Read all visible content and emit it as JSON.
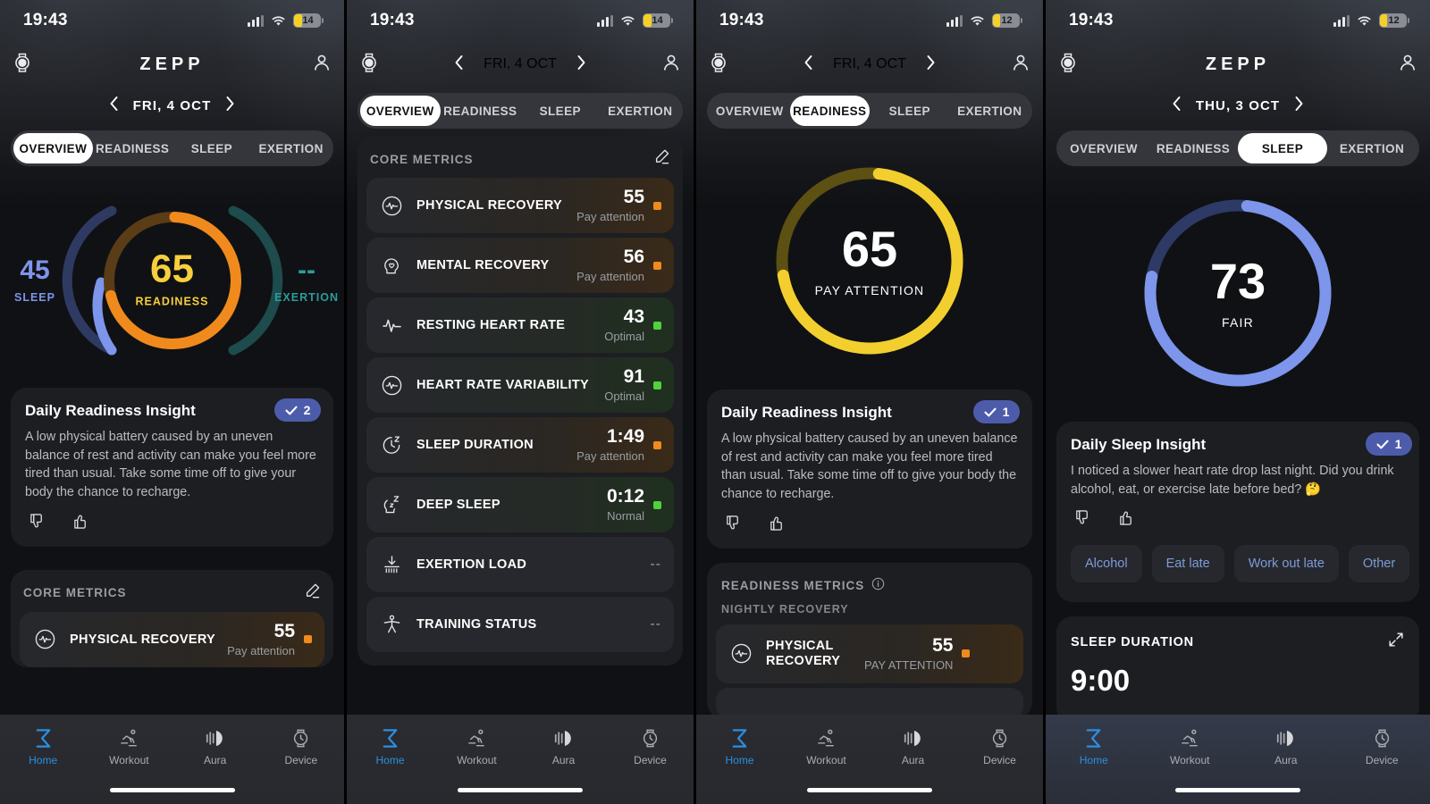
{
  "app": {
    "brand": "ZEPP",
    "watch_icon": "watch-icon",
    "profile_icon": "profile-icon"
  },
  "colors": {
    "readiness": "#f08a1c",
    "readiness_text": "#f7cf3c",
    "sleep": "#7d95ea",
    "exertion": "#2a9d9a",
    "warn_dot": "#f08a1c",
    "good_dot": "#4fd23a",
    "accent_blue": "#2b8fe0",
    "badge_blue": "#4d5caa",
    "pay_attention_ring": "#f2cf2e"
  },
  "bottom_nav": [
    {
      "label": "Home",
      "icon": "sigma-icon",
      "active": true
    },
    {
      "label": "Workout",
      "icon": "running-icon",
      "active": false
    },
    {
      "label": "Aura",
      "icon": "aura-waves-icon",
      "active": false
    },
    {
      "label": "Device",
      "icon": "watch-device-icon",
      "active": false
    }
  ],
  "tabs_labels": [
    "OVERVIEW",
    "READINESS",
    "SLEEP",
    "EXERTION"
  ],
  "panels": [
    {
      "id": "panel-overview",
      "status": {
        "time": "19:43",
        "battery": "14",
        "signal": "cellular-icon",
        "wifi": "wifi-icon"
      },
      "date": "FRI, 4 OCT",
      "active_tab": "OVERVIEW",
      "rings": {
        "sleep": {
          "value": "45",
          "label": "SLEEP"
        },
        "readiness": {
          "value": "65",
          "label": "READINESS"
        },
        "exertion": {
          "value": "--",
          "label": "EXERTION"
        }
      },
      "insight": {
        "title": "Daily Readiness Insight",
        "body": "A low physical battery caused by an uneven balance of rest and activity can make you feel more tired than usual. Take some time off to give your body the chance to recharge.",
        "badge_count": "2",
        "thumbs_down": "thumbs-down-icon",
        "thumbs_up": "thumbs-up-icon"
      },
      "core_metrics": {
        "title": "CORE METRICS",
        "edit_icon": "pencil-icon",
        "rows": [
          {
            "icon": "physical-recovery-icon",
            "label": "PHYSICAL RECOVERY",
            "value": "55",
            "status": "Pay attention",
            "dot": "orange"
          }
        ]
      }
    },
    {
      "id": "panel-core-metrics",
      "status": {
        "time": "19:43",
        "battery": "14",
        "signal": "cellular-icon",
        "wifi": "wifi-icon"
      },
      "date": "FRI, 4 OCT",
      "active_tab": "OVERVIEW",
      "core_metrics": {
        "title": "CORE METRICS",
        "edit_icon": "pencil-icon",
        "rows": [
          {
            "icon": "physical-recovery-icon",
            "label": "PHYSICAL RECOVERY",
            "value": "55",
            "status": "Pay attention",
            "dot": "orange"
          },
          {
            "icon": "mental-recovery-icon",
            "label": "MENTAL RECOVERY",
            "value": "56",
            "status": "Pay attention",
            "dot": "orange"
          },
          {
            "icon": "heart-rate-icon",
            "label": "RESTING HEART RATE",
            "value": "43",
            "status": "Optimal",
            "dot": "green"
          },
          {
            "icon": "hrv-icon",
            "label": "HEART RATE VARIABILITY",
            "value": "91",
            "status": "Optimal",
            "dot": "green"
          },
          {
            "icon": "sleep-duration-icon",
            "label": "SLEEP DURATION",
            "value": "1:49",
            "status": "Pay attention",
            "dot": "orange"
          },
          {
            "icon": "deep-sleep-icon",
            "label": "DEEP SLEEP",
            "value": "0:12",
            "status": "Normal",
            "dot": "green"
          },
          {
            "icon": "exertion-load-icon",
            "label": "EXERTION LOAD",
            "value": "--",
            "status": "",
            "dot": "none"
          },
          {
            "icon": "training-status-icon",
            "label": "TRAINING STATUS",
            "value": "--",
            "status": "",
            "dot": "none"
          }
        ]
      }
    },
    {
      "id": "panel-readiness",
      "status": {
        "time": "19:43",
        "battery": "12",
        "signal": "cellular-icon",
        "wifi": "wifi-icon"
      },
      "date": "FRI, 4 OCT",
      "active_tab": "READINESS",
      "ring": {
        "value": "65",
        "label": "PAY ATTENTION"
      },
      "insight": {
        "title": "Daily Readiness Insight",
        "body": "A low physical battery caused by an uneven balance of rest and activity can make you feel more tired than usual. Take some time off to give your body the chance to recharge.",
        "badge_count": "1",
        "thumbs_down": "thumbs-down-icon",
        "thumbs_up": "thumbs-up-icon"
      },
      "metrics_section": {
        "title": "READINESS METRICS",
        "info_icon": "info-icon",
        "subtitle": "NIGHTLY RECOVERY",
        "rows": [
          {
            "icon": "physical-recovery-icon",
            "label": "PHYSICAL RECOVERY",
            "value": "55",
            "status": "PAY ATTENTION",
            "dot": "orange"
          }
        ]
      }
    },
    {
      "id": "panel-sleep",
      "status": {
        "time": "19:43",
        "battery": "12",
        "signal": "cellular-icon",
        "wifi": "wifi-icon"
      },
      "date": "THU, 3 OCT",
      "active_tab": "SLEEP",
      "ring": {
        "value": "73",
        "label": "FAIR"
      },
      "insight": {
        "title": "Daily Sleep Insight",
        "body": "I noticed a slower heart rate drop last night. Did you drink alcohol, eat, or exercise late before bed? 🤔",
        "badge_count": "1",
        "thumbs_down": "thumbs-down-icon",
        "thumbs_up": "thumbs-up-icon",
        "chips": [
          "Alcohol",
          "Eat late",
          "Work out late",
          "Other"
        ]
      },
      "sleep_duration": {
        "title": "SLEEP DURATION",
        "expand_icon": "expand-icon",
        "value": "9:00"
      }
    }
  ]
}
